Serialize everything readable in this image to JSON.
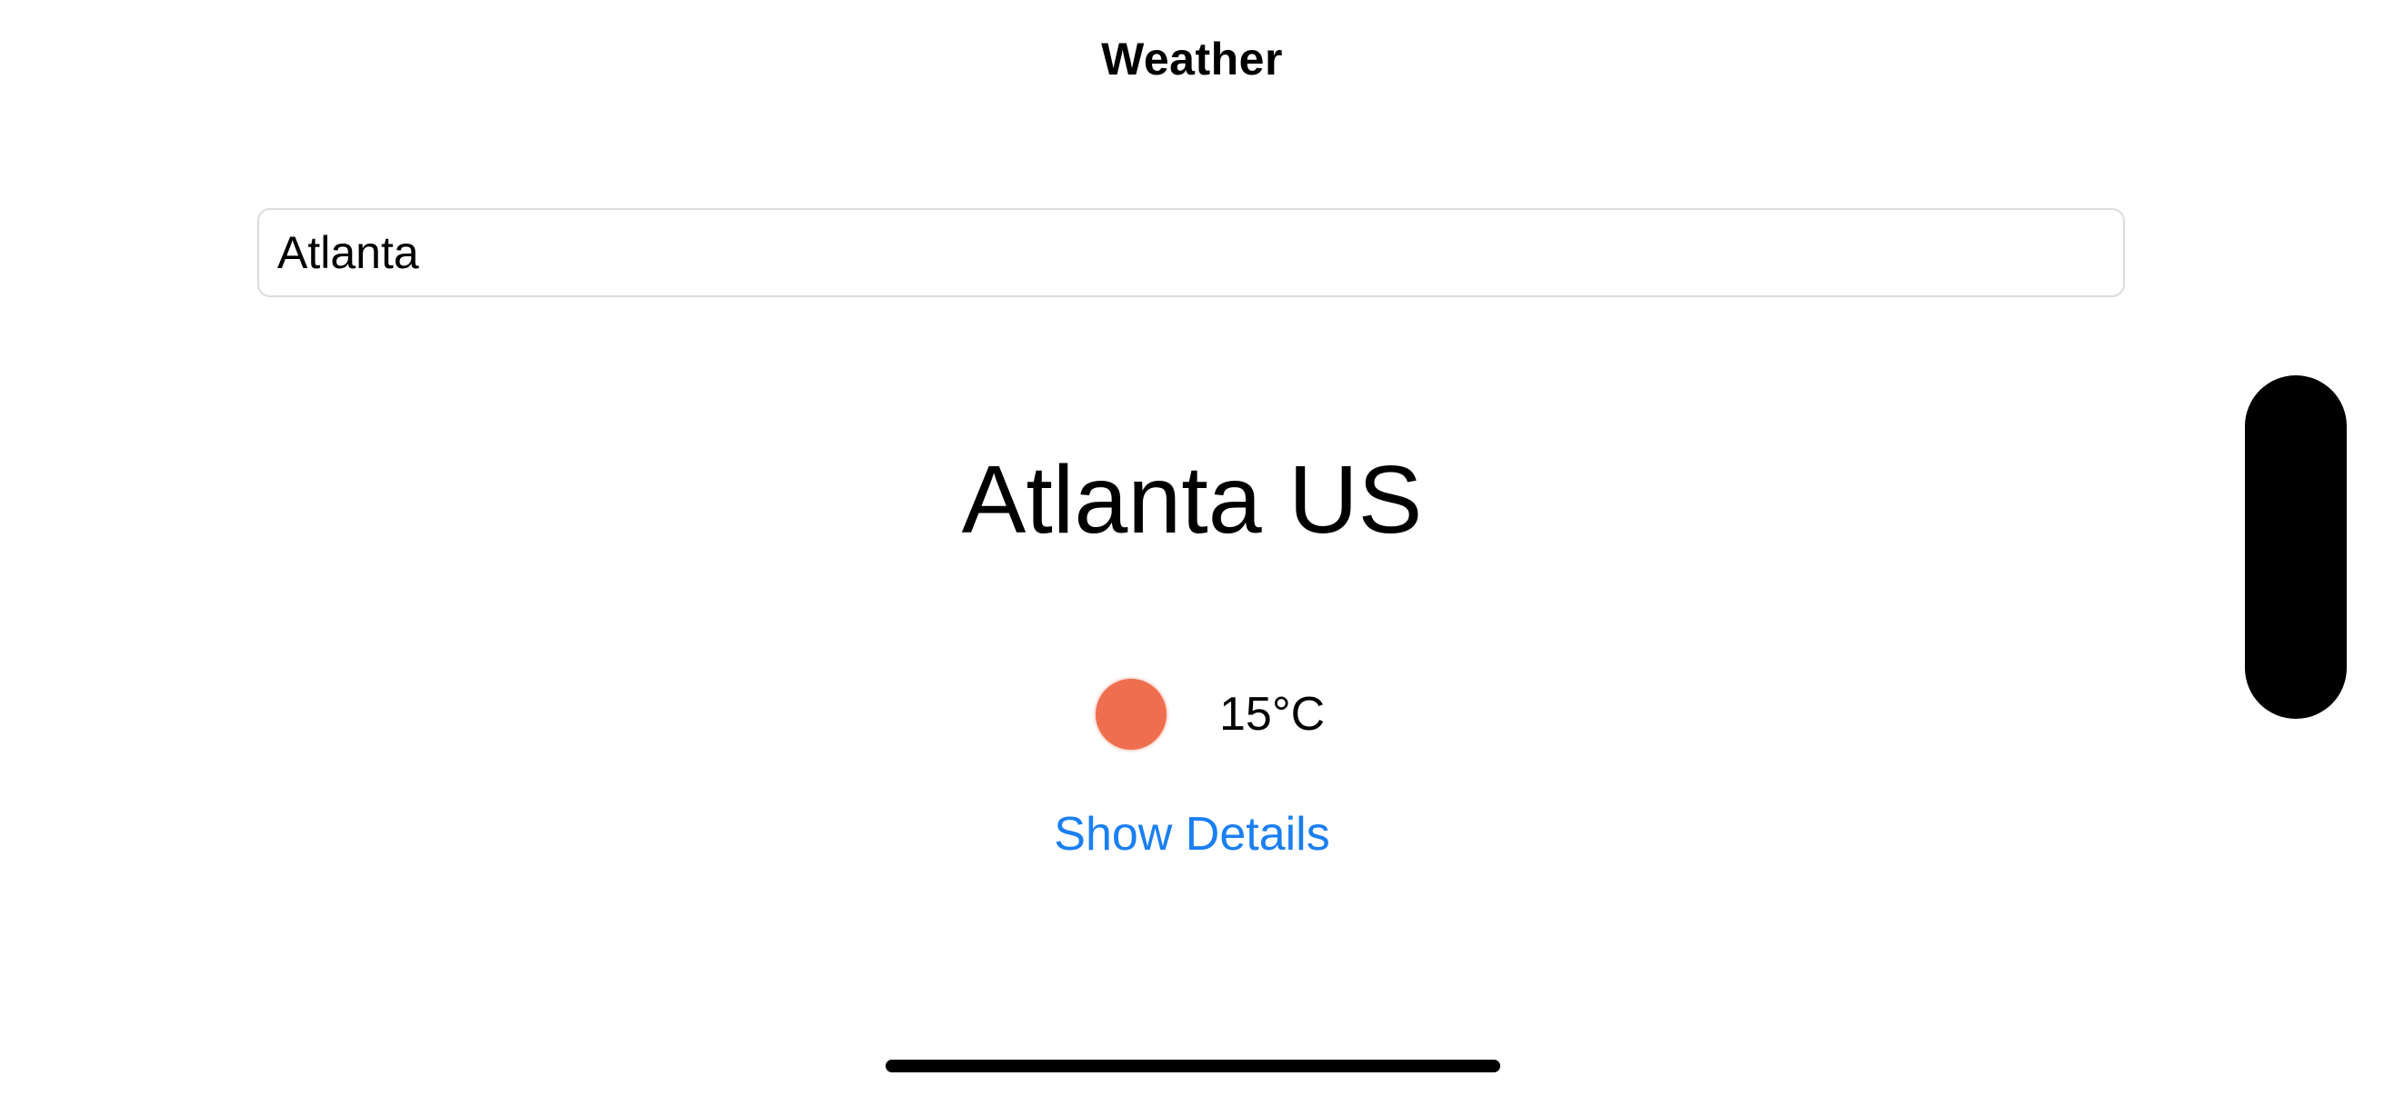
{
  "nav": {
    "title": "Weather"
  },
  "search": {
    "value": "Atlanta",
    "placeholder": ""
  },
  "weather": {
    "location": "Atlanta US",
    "temperature": "15°C",
    "icon": "sun-icon",
    "icon_color": "#ee6e4f"
  },
  "actions": {
    "details_label": "Show Details"
  },
  "colors": {
    "link": "#1a7ff2"
  }
}
